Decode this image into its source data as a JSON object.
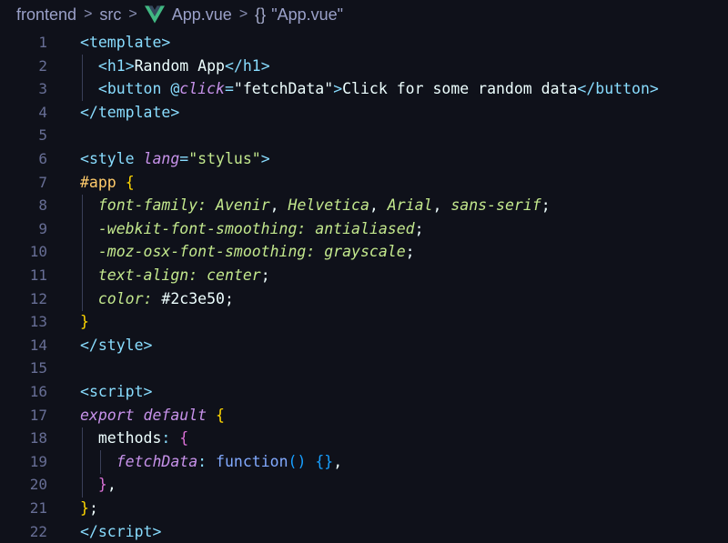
{
  "breadcrumb": {
    "items": [
      "frontend",
      "src",
      "App.vue",
      "\"App.vue\""
    ],
    "braces": "{}",
    "icons": [
      "vue-logo-icon",
      "braces-icon"
    ]
  },
  "editor": {
    "colors": {
      "background": "#0f111a",
      "line_number": "#676e95",
      "vue_green": "#41b883"
    },
    "lines": [
      {
        "n": "1",
        "tokens": [
          [
            "t-tag",
            "<"
          ],
          [
            "t-tag",
            "template"
          ],
          [
            "t-tag",
            ">"
          ]
        ]
      },
      {
        "n": "2",
        "tokens": [
          [
            "t-plain",
            "  "
          ],
          [
            "t-tag",
            "<"
          ],
          [
            "t-tag",
            "h1"
          ],
          [
            "t-tag",
            ">"
          ],
          [
            "t-text",
            "Random App"
          ],
          [
            "t-tag",
            "</"
          ],
          [
            "t-tag",
            "h1"
          ],
          [
            "t-tag",
            ">"
          ]
        ]
      },
      {
        "n": "3",
        "tokens": [
          [
            "t-plain",
            "  "
          ],
          [
            "t-tag",
            "<"
          ],
          [
            "t-tag",
            "button"
          ],
          [
            "t-plain",
            " "
          ],
          [
            "t-punct",
            "@"
          ],
          [
            "t-attr",
            "click"
          ],
          [
            "t-punct",
            "="
          ],
          [
            "t-plain",
            "\"fetchData\""
          ],
          [
            "t-tag",
            ">"
          ],
          [
            "t-text",
            "Click for some random data"
          ],
          [
            "t-tag",
            "</"
          ],
          [
            "t-tag",
            "button"
          ],
          [
            "t-tag",
            ">"
          ]
        ]
      },
      {
        "n": "4",
        "tokens": [
          [
            "t-tag",
            "</"
          ],
          [
            "t-tag",
            "template"
          ],
          [
            "t-tag",
            ">"
          ]
        ]
      },
      {
        "n": "5",
        "tokens": []
      },
      {
        "n": "6",
        "tokens": [
          [
            "t-tag",
            "<"
          ],
          [
            "t-tag",
            "style"
          ],
          [
            "t-plain",
            " "
          ],
          [
            "t-attr",
            "lang"
          ],
          [
            "t-punct",
            "="
          ],
          [
            "t-str",
            "\"stylus\""
          ],
          [
            "t-tag",
            ">"
          ]
        ]
      },
      {
        "n": "7",
        "tokens": [
          [
            "t-sel",
            "#app"
          ],
          [
            "t-plain",
            " "
          ],
          [
            "t-brace1",
            "{"
          ]
        ]
      },
      {
        "n": "8",
        "tokens": [
          [
            "t-plain",
            "  "
          ],
          [
            "t-prop",
            "font-family"
          ],
          [
            "t-prop",
            ":"
          ],
          [
            "t-prop",
            " Avenir"
          ],
          [
            "t-plain",
            ", "
          ],
          [
            "t-prop",
            "Helvetica"
          ],
          [
            "t-plain",
            ", "
          ],
          [
            "t-prop",
            "Arial"
          ],
          [
            "t-plain",
            ", "
          ],
          [
            "t-prop",
            "sans-serif"
          ],
          [
            "t-plain",
            ";"
          ]
        ]
      },
      {
        "n": "9",
        "tokens": [
          [
            "t-plain",
            "  "
          ],
          [
            "t-prop",
            "-webkit-font-smoothing: antialiased"
          ],
          [
            "t-plain",
            ";"
          ]
        ]
      },
      {
        "n": "10",
        "tokens": [
          [
            "t-plain",
            "  "
          ],
          [
            "t-prop",
            "-moz-osx-font-smoothing: grayscale"
          ],
          [
            "t-plain",
            ";"
          ]
        ]
      },
      {
        "n": "11",
        "tokens": [
          [
            "t-plain",
            "  "
          ],
          [
            "t-prop",
            "text-align: center"
          ],
          [
            "t-plain",
            ";"
          ]
        ]
      },
      {
        "n": "12",
        "tokens": [
          [
            "t-plain",
            "  "
          ],
          [
            "t-prop",
            "color:"
          ],
          [
            "t-plain",
            " #2c3e50;"
          ]
        ]
      },
      {
        "n": "13",
        "tokens": [
          [
            "t-brace1",
            "}"
          ]
        ]
      },
      {
        "n": "14",
        "tokens": [
          [
            "t-tag",
            "</"
          ],
          [
            "t-tag",
            "style"
          ],
          [
            "t-tag",
            ">"
          ]
        ]
      },
      {
        "n": "15",
        "tokens": []
      },
      {
        "n": "16",
        "tokens": [
          [
            "t-tag",
            "<"
          ],
          [
            "t-tag",
            "script"
          ],
          [
            "t-tag",
            ">"
          ]
        ]
      },
      {
        "n": "17",
        "tokens": [
          [
            "t-kw",
            "export"
          ],
          [
            "t-plain",
            " "
          ],
          [
            "t-kw",
            "default"
          ],
          [
            "t-plain",
            " "
          ],
          [
            "t-brace1",
            "{"
          ]
        ]
      },
      {
        "n": "18",
        "tokens": [
          [
            "t-plain",
            "  methods"
          ],
          [
            "t-punct",
            ":"
          ],
          [
            "t-plain",
            " "
          ],
          [
            "t-brace2",
            "{"
          ]
        ]
      },
      {
        "n": "19",
        "tokens": [
          [
            "t-plain",
            "    "
          ],
          [
            "t-attr",
            "fetchData"
          ],
          [
            "t-punct",
            ":"
          ],
          [
            "t-plain",
            " "
          ],
          [
            "t-fn",
            "function"
          ],
          [
            "t-brace3",
            "()"
          ],
          [
            "t-plain",
            " "
          ],
          [
            "t-brace3",
            "{}"
          ],
          [
            "t-plain",
            ","
          ]
        ]
      },
      {
        "n": "20",
        "tokens": [
          [
            "t-plain",
            "  "
          ],
          [
            "t-brace2",
            "}"
          ],
          [
            "t-plain",
            ","
          ]
        ]
      },
      {
        "n": "21",
        "tokens": [
          [
            "t-brace1",
            "}"
          ],
          [
            "t-plain",
            ";"
          ]
        ]
      },
      {
        "n": "22",
        "tokens": [
          [
            "t-tag",
            "</"
          ],
          [
            "t-tag",
            "script"
          ],
          [
            "t-tag",
            ">"
          ]
        ]
      }
    ]
  }
}
